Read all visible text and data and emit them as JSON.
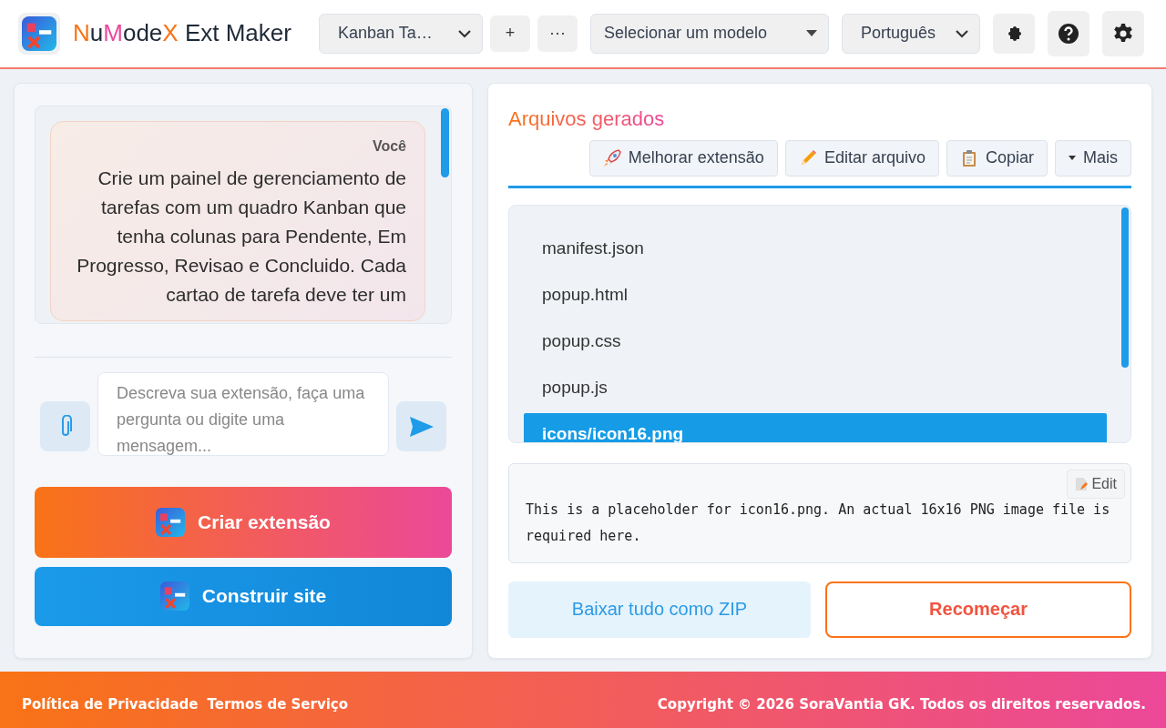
{
  "header": {
    "title_parts": [
      {
        "text": "N",
        "kind": "accent"
      },
      {
        "text": "u",
        "kind": "plain"
      },
      {
        "text": "M",
        "kind": "accent2"
      },
      {
        "text": "ode",
        "kind": "plain"
      },
      {
        "text": "X",
        "kind": "accent"
      },
      {
        "text": " Ext Maker",
        "kind": "plain"
      }
    ],
    "project_select": {
      "value": "Kanban Ta…"
    },
    "add_button": "+",
    "more_button": "···",
    "model_select": {
      "value": "Selecionar um modelo"
    },
    "language_select": {
      "value": "Português"
    }
  },
  "chat": {
    "messages": [
      {
        "author": "Você",
        "text": "Crie um painel de gerenciamento de tarefas com um quadro Kanban que tenha colunas para Pendente, Em Progresso, Revisao e Concluido. Cada cartao de tarefa deve ter um"
      }
    ],
    "input": {
      "placeholder": "Descreva sua extensão, faça uma pergunta ou digite uma mensagem..."
    }
  },
  "actions": [
    {
      "label": "Criar extensão",
      "kind": "primary"
    },
    {
      "label": "Construir site",
      "kind": "secondary"
    }
  ],
  "files_panel": {
    "title": "Arquivos gerados",
    "toolbar": [
      {
        "label": "Melhorar extensão",
        "kind": "rocket"
      },
      {
        "label": "Editar arquivo",
        "kind": "pencil"
      },
      {
        "label": "Copiar",
        "kind": "clipboard"
      },
      {
        "label": "Mais",
        "kind": "caret"
      }
    ],
    "files": [
      {
        "name": "manifest.json",
        "selected": false
      },
      {
        "name": "popup.html",
        "selected": false
      },
      {
        "name": "popup.css",
        "selected": false
      },
      {
        "name": "popup.js",
        "selected": false
      },
      {
        "name": "icons/icon16.png",
        "selected": true
      }
    ],
    "preview": {
      "edit_button": "Edit",
      "content": "This is a placeholder for icon16.png. An actual 16x16 PNG image file is required here."
    },
    "download_button": "Baixar tudo como ZIP",
    "restart_button": "Recomeçar"
  },
  "footer": {
    "links": [
      "Política de Privacidade",
      "Termos de Serviço"
    ],
    "copyright": "Copyright © 2026 SoraVantia GK. Todos os direitos reservados."
  }
}
